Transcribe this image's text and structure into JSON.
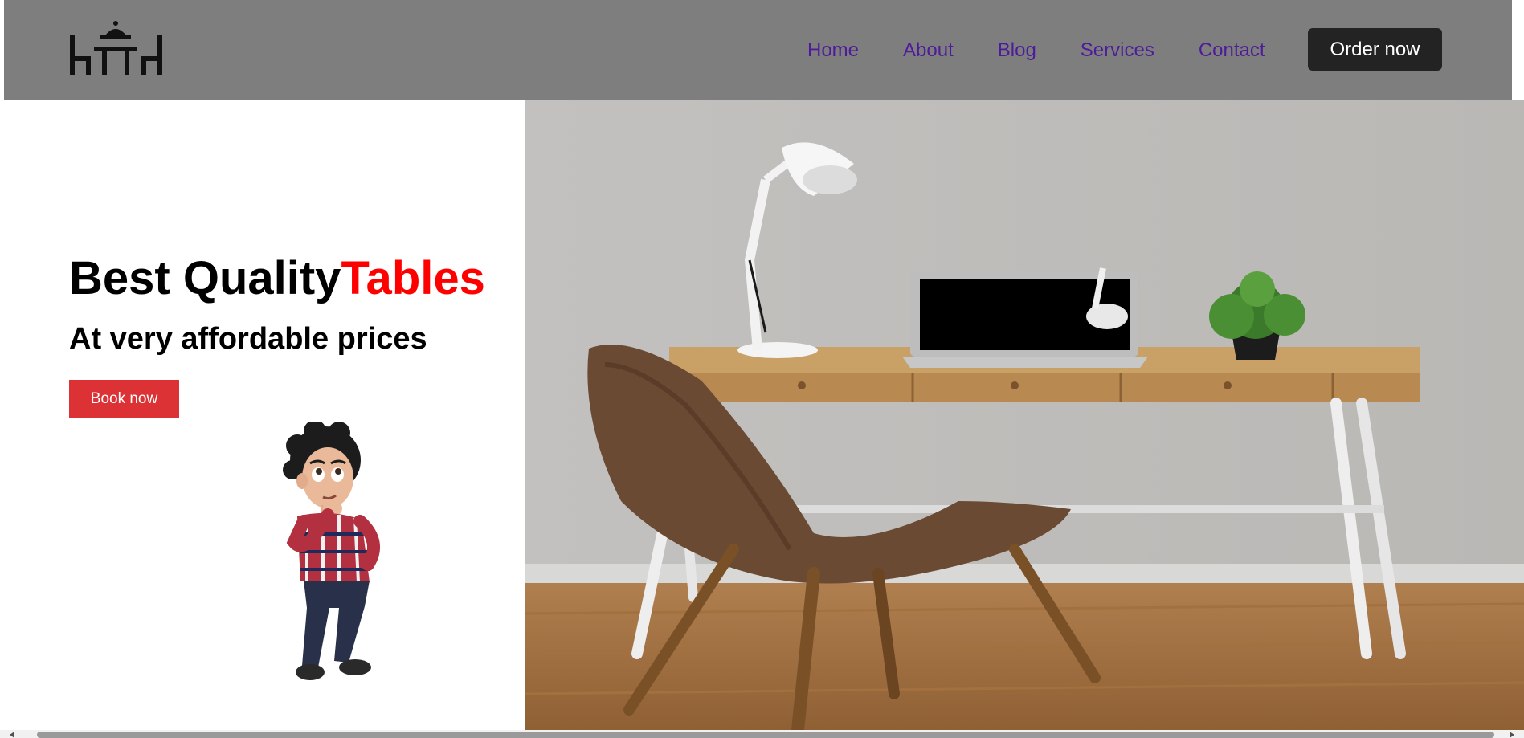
{
  "brand": {
    "logo_icon": "table-chairs-logo-icon"
  },
  "nav": {
    "links": [
      {
        "label": "Home"
      },
      {
        "label": "About"
      },
      {
        "label": "Blog"
      },
      {
        "label": "Services"
      },
      {
        "label": "Contact"
      }
    ],
    "order_label": "Order now"
  },
  "hero": {
    "title_main": "Best Quality",
    "title_accent": "Tables",
    "subtitle": "At very affordable prices",
    "cta_label": "Book now",
    "avatar_icon": "thinking-cartoon-man-illustration",
    "photo_icon": "desk-chair-lamp-laptop-photo"
  },
  "colors": {
    "navbar_bg": "#7e7e7e",
    "nav_link": "#4e1c9a",
    "order_button": "#232323",
    "accent_red": "#ff0000",
    "cta_button": "#dc3236"
  }
}
